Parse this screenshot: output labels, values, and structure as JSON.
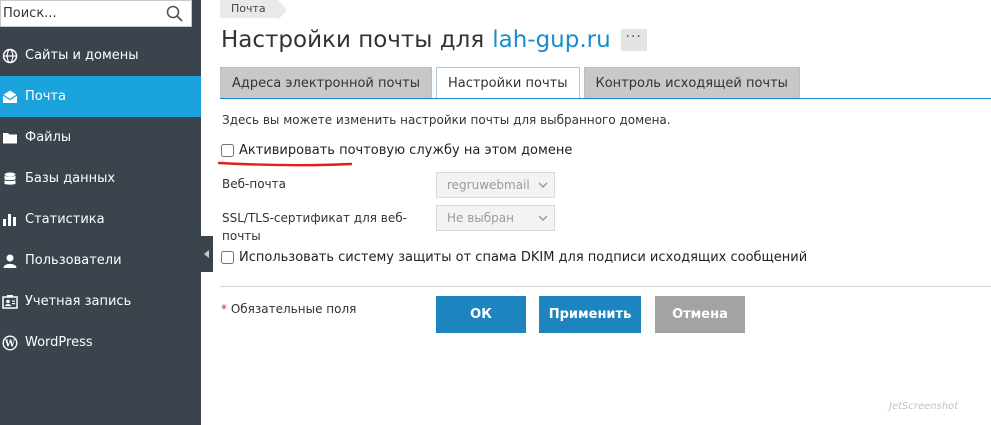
{
  "sidebar": {
    "search_placeholder": "Поиск...",
    "items": [
      {
        "label": "Сайты и домены",
        "icon": "globe-icon",
        "active": false
      },
      {
        "label": "Почта",
        "icon": "mail-icon",
        "active": true
      },
      {
        "label": "Файлы",
        "icon": "folder-icon",
        "active": false
      },
      {
        "label": "Базы данных",
        "icon": "database-icon",
        "active": false
      },
      {
        "label": "Статистика",
        "icon": "bar-chart-icon",
        "active": false
      },
      {
        "label": "Пользователи",
        "icon": "user-icon",
        "active": false
      },
      {
        "label": "Учетная запись",
        "icon": "account-card-icon",
        "active": false
      },
      {
        "label": "WordPress",
        "icon": "wordpress-icon",
        "active": false
      }
    ]
  },
  "breadcrumb": {
    "item": "Почта"
  },
  "header": {
    "title": "Настройки почты для",
    "domain": "lah-gup.ru",
    "more": "···"
  },
  "tabs": [
    {
      "label": "Адреса электронной почты",
      "active": false
    },
    {
      "label": "Настройки почты",
      "active": true
    },
    {
      "label": "Контроль исходящей почты",
      "active": false
    }
  ],
  "form": {
    "intro": "Здесь вы можете изменить настройки почты для выбранного домена.",
    "activate_label": "Активировать почтовую службу на этом домене",
    "webmail_label": "Веб-почта",
    "webmail_value": "regruwebmail",
    "ssl_label_line1": "SSL/TLS-сертификат для веб-",
    "ssl_label_line2": "почты",
    "ssl_value": "Не выбран",
    "dkim_label": "Использовать систему защиты от спама DKIM для подписи исходящих сообщений"
  },
  "footer": {
    "required_star": "*",
    "required_text": "Обязательные поля",
    "ok_label": "ОК",
    "apply_label": "Применить",
    "cancel_label": "Отмена"
  },
  "watermark": "JetScreenshot",
  "colors": {
    "accent": "#1aa3dc",
    "sidebar_bg": "#3b444c",
    "primary_button": "#1d84bf",
    "cancel_button": "#a3a3a3",
    "annotation_red": "#e0201b"
  }
}
